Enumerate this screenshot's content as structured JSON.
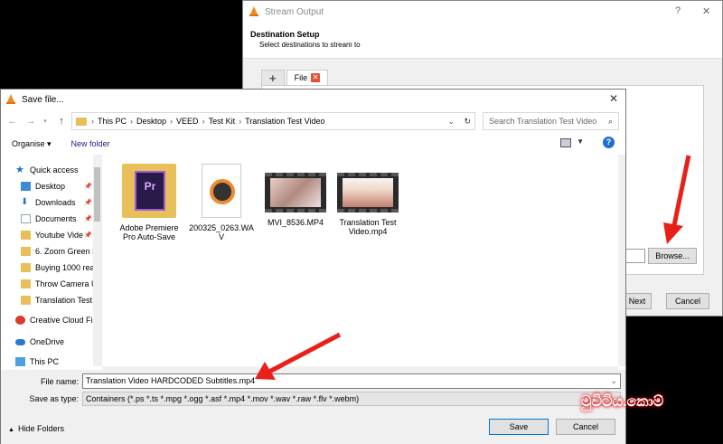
{
  "stream_output": {
    "title": "Stream Output",
    "help": "?",
    "close": "✕",
    "header_title": "Destination Setup",
    "header_subtitle": "Select destinations to stream to",
    "tab_add": "+",
    "tab_file": "File",
    "browse": "Browse...",
    "next": "Next",
    "cancel": "Cancel"
  },
  "save_dialog": {
    "title": "Save file...",
    "close": "✕",
    "breadcrumb": [
      "This PC",
      "Desktop",
      "VEED",
      "Test Kit",
      "Translation Test Video"
    ],
    "search_placeholder": "Search Translation Test Video",
    "organise": "Organise ▾",
    "new_folder": "New folder",
    "help": "?",
    "nav": [
      {
        "label": "Quick access",
        "icon": "star-icon"
      },
      {
        "label": "Desktop",
        "icon": "desktop-icon",
        "pinned": true
      },
      {
        "label": "Downloads",
        "icon": "download-icon",
        "pinned": true
      },
      {
        "label": "Documents",
        "icon": "documents-icon",
        "pinned": true
      },
      {
        "label": "Youtube Vide",
        "icon": "folder-icon",
        "pinned": true
      },
      {
        "label": "6. Zoom Green S",
        "icon": "folder-icon"
      },
      {
        "label": "Buying 1000 real",
        "icon": "folder-icon"
      },
      {
        "label": "Throw Camera U",
        "icon": "folder-icon"
      },
      {
        "label": "Translation Test V",
        "icon": "folder-icon"
      },
      {
        "label": "Creative Cloud Fil",
        "icon": "creative-cloud-icon"
      },
      {
        "label": "OneDrive",
        "icon": "onedrive-icon"
      },
      {
        "label": "This PC",
        "icon": "pc-icon"
      }
    ],
    "files": [
      {
        "name": "Adobe Premiere Pro Auto-Save",
        "type": "folder"
      },
      {
        "name": "200325_0263.WAV",
        "type": "audio"
      },
      {
        "name": "MVI_8536.MP4",
        "type": "video"
      },
      {
        "name": "Translation Test Video.mp4",
        "type": "video"
      }
    ],
    "file_name_label": "File name:",
    "file_name_value": "Translation Video HARDCODED Subtitles.mp4",
    "save_as_label": "Save as type:",
    "save_as_value": "Containers (*.ps *.ts *.mpg *.ogg *.asf *.mp4 *.mov *.wav *.raw *.flv *.webm)",
    "hide_folders": "Hide Folders",
    "save": "Save",
    "cancel": "Cancel"
  },
  "watermark": "මුවිටිය.කොම්",
  "colors": {
    "arrow": "#e8201a",
    "accent": "#0078d7"
  }
}
